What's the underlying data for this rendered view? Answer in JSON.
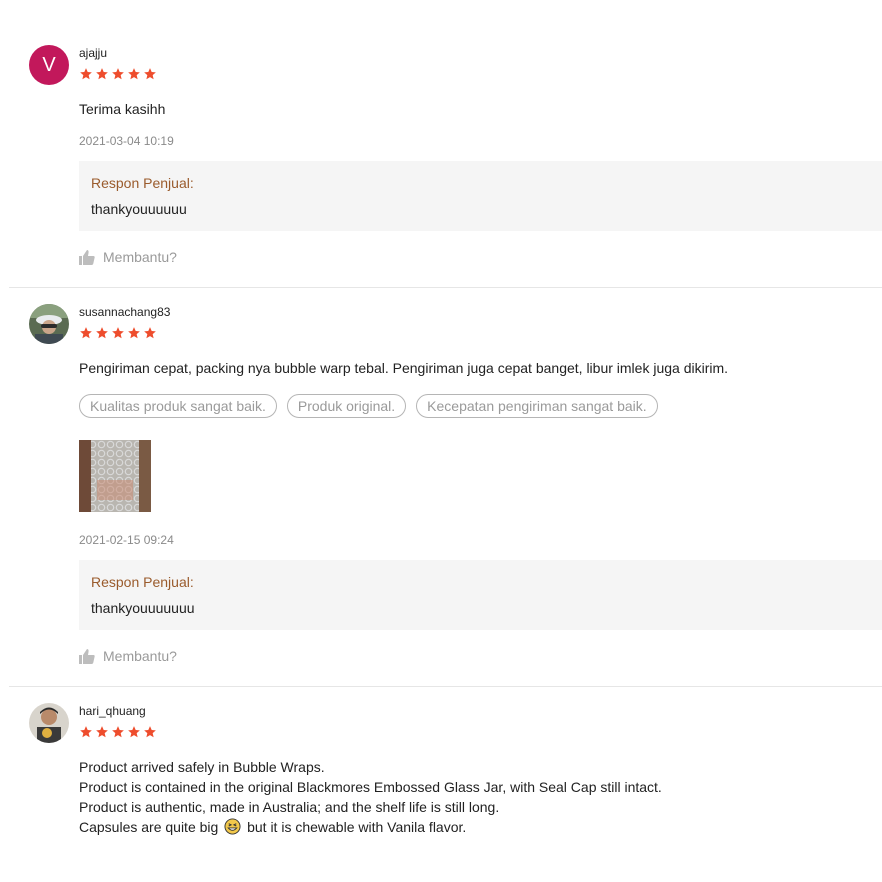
{
  "reviews": [
    {
      "username": "ajajju",
      "avatar_letter": "V",
      "rating": 5,
      "text": "Terima kasihh",
      "date": "2021-03-04 10:19",
      "response_label": "Respon Penjual:",
      "response_text": "thankyouuuuuu",
      "helpful_label": "Membantu?"
    },
    {
      "username": "susannachang83",
      "rating": 5,
      "text": "Pengiriman cepat, packing nya bubble warp tebal. Pengiriman juga cepat banget, libur imlek juga dikirim.",
      "tags": [
        "Kualitas produk sangat baik.",
        "Produk original.",
        "Kecepatan pengiriman sangat baik."
      ],
      "date": "2021-02-15 09:24",
      "response_label": "Respon Penjual:",
      "response_text": "thankyouuuuuuu",
      "helpful_label": "Membantu?"
    },
    {
      "username": "hari_qhuang",
      "rating": 5,
      "lines": [
        "Product arrived safely in Bubble Wraps.",
        "Product is contained in the original Blackmores Embossed Glass Jar, with Seal Cap still intact.",
        "Product is authentic, made in Australia; and the shelf life is still long.",
        "Capsules are quite big",
        "but it is chewable with Vanila flavor."
      ]
    }
  ],
  "colors": {
    "star": "#ee4d2d",
    "response_label": "#9a5b2c",
    "avatar_v": "#c2185b"
  },
  "icons": [
    "star-icon",
    "thumbs-up-icon",
    "grinning-emoji-icon"
  ]
}
